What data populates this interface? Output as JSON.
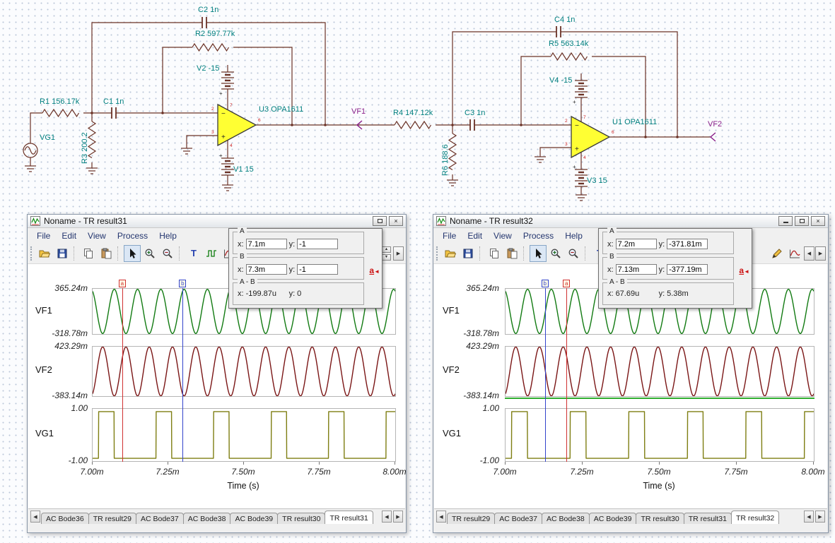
{
  "glyphs": {
    "close": "×",
    "left": "◀",
    "right": "▶",
    "up": "▲",
    "down": "▼",
    "text_tool": "T",
    "jump_arrow": "◄"
  },
  "schematic": {
    "label_color": "#007f7f",
    "probe_color": "#8a1f8a",
    "wire_color": "#6b3226",
    "opamp_fill": "#ffff33",
    "labels": {
      "c2": "C2 1n",
      "r2": "R2 597.77k",
      "v2": "V2 -15",
      "r1": "R1 156.17k",
      "c1": "C1 1n",
      "vg1": "VG1",
      "r3": "R3 200.2",
      "u3": "U3 OPA1611",
      "v1": "V1 15",
      "vf1": "VF1",
      "r4": "R4 147.12k",
      "c3": "C3 1n",
      "r6": "R6 188.6",
      "c4": "C4 1n",
      "r5": "R5 563.14k",
      "v4": "V4 -15",
      "u1": "U1 OPA1611",
      "v3": "V3 15",
      "vf2": "VF2"
    },
    "opamp_minus": "−",
    "opamp_plus": "+",
    "plus_sign": "+",
    "opamp_pins": {
      "inv": "2",
      "nin": "3",
      "vplus": "7",
      "vminus": "4",
      "out": "6"
    }
  },
  "windows": [
    {
      "title": "Noname - TR result31",
      "menu": {
        "file": "File",
        "edit": "Edit",
        "view": "View",
        "process": "Process",
        "help": "Help"
      },
      "cursor_panel": {
        "a_title": "A",
        "b_title": "B",
        "ab_title": "A - B",
        "x_label": "x:",
        "y_label": "y:",
        "a_x": "7.1m",
        "a_y": "-1",
        "b_x": "7.3m",
        "b_y": "-1",
        "ab_x_label": "x:",
        "ab_x_value": "-199.87u",
        "ab_y_label": "y:",
        "ab_y_value": "0",
        "jump_label": "a"
      },
      "tabs": [
        "AC Bode36",
        "TR result29",
        "AC Bode37",
        "AC Bode38",
        "AC Bode39",
        "TR result30",
        "TR result31"
      ],
      "active_tab": "TR result31"
    },
    {
      "title": "Noname - TR result32",
      "menu": {
        "file": "File",
        "edit": "Edit",
        "view": "View",
        "process": "Process",
        "help": "Help"
      },
      "cursor_panel": {
        "a_title": "A",
        "b_title": "B",
        "ab_title": "A - B",
        "x_label": "x:",
        "y_label": "y:",
        "a_x": "7.2m",
        "a_y": "-371.81m",
        "b_x": "7.13m",
        "b_y": "-377.19m",
        "ab_x_label": "x:",
        "ab_x_value": "67.69u",
        "ab_y_label": "y:",
        "ab_y_value": "5.38m",
        "jump_label": "a"
      },
      "tabs": [
        "TR result29",
        "AC Bode37",
        "AC Bode38",
        "AC Bode39",
        "TR result30",
        "TR result31",
        "TR result32"
      ],
      "active_tab": "TR result32"
    }
  ],
  "chart_data": [
    {
      "type": "line",
      "x_label": "Time (s)",
      "x_ticks": [
        "7.00m",
        "7.25m",
        "7.50m",
        "7.75m",
        "8.00m"
      ],
      "x_range": [
        "7.00m",
        "8.00m"
      ],
      "grid": false,
      "series": [
        {
          "name": "VF1",
          "color": "#117a11",
          "kind": "sine",
          "cycles": 13,
          "amplitude": 0.335,
          "offset": 0.023,
          "phase": 2.0,
          "ylim": [
            -0.31878,
            0.36524
          ],
          "ymax_label": "365.24m",
          "ymin_label": "-318.78m"
        },
        {
          "name": "VF2",
          "color": "#7a1515",
          "kind": "sine",
          "cycles": 13,
          "amplitude": 0.4,
          "offset": 0.02,
          "phase": 5.14,
          "ylim": [
            -0.38314,
            0.42329
          ],
          "ymax_label": "423.29m",
          "ymin_label": "-383.14m"
        },
        {
          "name": "VG1",
          "color": "#7e7e12",
          "kind": "square",
          "period": 0.19,
          "duty": 0.27,
          "t0": 0.02,
          "high": 1,
          "low": -1,
          "ylim": [
            -1.12,
            1.12
          ],
          "ymax_label": "1.00",
          "ymin_label": "-1.00"
        }
      ],
      "cursors": [
        {
          "id": "a",
          "color": "#d03131",
          "frac": 0.1,
          "x": "7.1m",
          "y": "-1"
        },
        {
          "id": "b",
          "color": "#3344cc",
          "frac": 0.3,
          "x": "7.3m",
          "y": "-1"
        }
      ],
      "delta": {
        "x": "-199.87u",
        "y": "0"
      }
    },
    {
      "type": "line",
      "x_label": "Time (s)",
      "x_ticks": [
        "7.00m",
        "7.25m",
        "7.50m",
        "7.75m",
        "8.00m"
      ],
      "x_range": [
        "7.00m",
        "8.00m"
      ],
      "grid": false,
      "series": [
        {
          "name": "VF1",
          "color": "#117a11",
          "kind": "sine",
          "cycles": 13,
          "amplitude": 0.335,
          "offset": 0.023,
          "phase": 2.0,
          "ylim": [
            -0.31878,
            0.36524
          ],
          "ymax_label": "365.24m",
          "ymin_label": "-318.78m"
        },
        {
          "name": "VF2",
          "color": "#7a1515",
          "kind": "sine",
          "cycles": 13,
          "amplitude": 0.4,
          "offset": 0.02,
          "phase": 5.14,
          "ylim": [
            -0.38314,
            0.42329
          ],
          "ymax_label": "423.29m",
          "ymin_label": "-383.14m"
        },
        {
          "name": "VG1",
          "color": "#7e7e12",
          "kind": "square",
          "period": 0.19,
          "duty": 0.27,
          "t0": 0.02,
          "high": 1,
          "low": -1,
          "ylim": [
            -1.12,
            1.12
          ],
          "ymax_label": "1.00",
          "ymin_label": "-1.00"
        }
      ],
      "cursors": [
        {
          "id": "a",
          "color": "#d03131",
          "frac": 0.2,
          "x": "7.2m",
          "y": "-371.81m"
        },
        {
          "id": "b",
          "color": "#3344cc",
          "frac": 0.13,
          "x": "7.13m",
          "y": "-377.19m"
        }
      ],
      "delta": {
        "x": "67.69u",
        "y": "5.38m"
      },
      "stray_line": {
        "color": "#2fae2f"
      }
    }
  ]
}
